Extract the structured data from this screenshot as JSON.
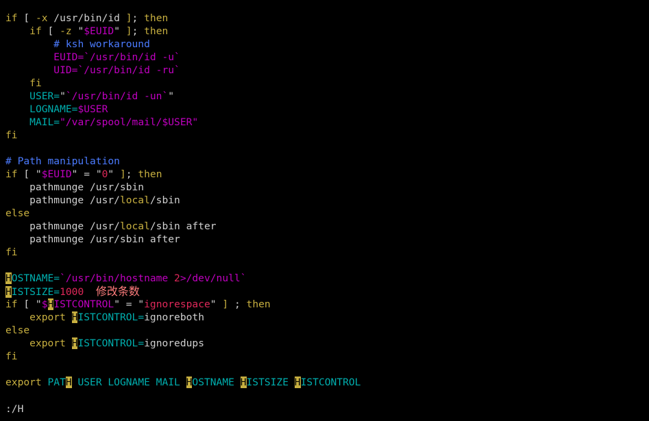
{
  "colors": {
    "background": "#000000",
    "default": "#d0d0d0",
    "keyword": "#c8b040",
    "variable": "#00afaf",
    "string": "#c000c0",
    "comment": "#4b7bff",
    "special": "#c000c0",
    "number": "#e0285a",
    "search_bg": "#c8b040",
    "search_fg": "#000000",
    "annotation": "#ff7d7d"
  },
  "editor": {
    "lines": [
      [
        {
          "t": "if",
          "c": "keyword"
        },
        {
          "t": " [ ",
          "c": "default"
        },
        {
          "t": "-x",
          "c": "keyword"
        },
        {
          "t": " /usr/bin/id ",
          "c": "default"
        },
        {
          "t": "]",
          "c": "keyword"
        },
        {
          "t": "; ",
          "c": "default"
        },
        {
          "t": "then",
          "c": "keyword"
        }
      ],
      [
        {
          "t": "    ",
          "c": "default"
        },
        {
          "t": "if",
          "c": "keyword"
        },
        {
          "t": " [ ",
          "c": "default"
        },
        {
          "t": "-z",
          "c": "keyword"
        },
        {
          "t": " \"",
          "c": "default"
        },
        {
          "t": "$EUID",
          "c": "special"
        },
        {
          "t": "\" ",
          "c": "default"
        },
        {
          "t": "]",
          "c": "keyword"
        },
        {
          "t": "; ",
          "c": "default"
        },
        {
          "t": "then",
          "c": "keyword"
        }
      ],
      [
        {
          "t": "        ",
          "c": "default"
        },
        {
          "t": "# ksh workaround",
          "c": "comment"
        }
      ],
      [
        {
          "t": "        ",
          "c": "default"
        },
        {
          "t": "EUID=",
          "c": "special"
        },
        {
          "t": "`/usr/bin/id -u`",
          "c": "string"
        }
      ],
      [
        {
          "t": "        ",
          "c": "default"
        },
        {
          "t": "UID=",
          "c": "special"
        },
        {
          "t": "`/usr/bin/id -ru`",
          "c": "string"
        }
      ],
      [
        {
          "t": "    ",
          "c": "default"
        },
        {
          "t": "fi",
          "c": "keyword"
        }
      ],
      [
        {
          "t": "    ",
          "c": "default"
        },
        {
          "t": "USER=",
          "c": "variable"
        },
        {
          "t": "\"",
          "c": "default"
        },
        {
          "t": "`/usr/bin/id -un`",
          "c": "string"
        },
        {
          "t": "\"",
          "c": "default"
        }
      ],
      [
        {
          "t": "    ",
          "c": "default"
        },
        {
          "t": "LOGNAME=",
          "c": "variable"
        },
        {
          "t": "$USER",
          "c": "special"
        }
      ],
      [
        {
          "t": "    ",
          "c": "default"
        },
        {
          "t": "MAIL=",
          "c": "variable"
        },
        {
          "t": "\"/var/spool/mail/$USER\"",
          "c": "string"
        }
      ],
      [
        {
          "t": "fi",
          "c": "keyword"
        }
      ],
      [],
      [
        {
          "t": "# Path manipulation",
          "c": "comment"
        }
      ],
      [
        {
          "t": "if",
          "c": "keyword"
        },
        {
          "t": " [ \"",
          "c": "default"
        },
        {
          "t": "$EUID",
          "c": "special"
        },
        {
          "t": "\" = \"",
          "c": "default"
        },
        {
          "t": "0",
          "c": "number"
        },
        {
          "t": "\" ",
          "c": "default"
        },
        {
          "t": "]",
          "c": "keyword"
        },
        {
          "t": "; ",
          "c": "default"
        },
        {
          "t": "then",
          "c": "keyword"
        }
      ],
      [
        {
          "t": "    pathmunge /usr/sbin",
          "c": "default"
        }
      ],
      [
        {
          "t": "    pathmunge /usr/",
          "c": "default"
        },
        {
          "t": "local",
          "c": "keyword"
        },
        {
          "t": "/sbin",
          "c": "default"
        }
      ],
      [
        {
          "t": "else",
          "c": "keyword"
        }
      ],
      [
        {
          "t": "    pathmunge /usr/",
          "c": "default"
        },
        {
          "t": "local",
          "c": "keyword"
        },
        {
          "t": "/sbin after",
          "c": "default"
        }
      ],
      [
        {
          "t": "    pathmunge /usr/sbin after",
          "c": "default"
        }
      ],
      [
        {
          "t": "fi",
          "c": "keyword"
        }
      ],
      [],
      [
        {
          "t": "H",
          "c": "search"
        },
        {
          "t": "OSTNAME=",
          "c": "variable"
        },
        {
          "t": "`/usr/bin/hostname ",
          "c": "string"
        },
        {
          "t": "2",
          "c": "number"
        },
        {
          "t": ">/dev/null`",
          "c": "string"
        }
      ],
      [
        {
          "t": "H",
          "c": "search"
        },
        {
          "t": "ISTSIZE=",
          "c": "variable"
        },
        {
          "t": "1000",
          "c": "number"
        },
        {
          "t": "  ",
          "c": "default"
        },
        {
          "t": "修改条数",
          "c": "annotation"
        }
      ],
      [
        {
          "t": "if",
          "c": "keyword"
        },
        {
          "t": " [ \"",
          "c": "default"
        },
        {
          "t": "$",
          "c": "special"
        },
        {
          "t": "H",
          "c": "search"
        },
        {
          "t": "ISTCONTROL",
          "c": "special"
        },
        {
          "t": "\" = \"",
          "c": "default"
        },
        {
          "t": "ignorespace",
          "c": "number"
        },
        {
          "t": "\" ",
          "c": "default"
        },
        {
          "t": "]",
          "c": "keyword"
        },
        {
          "t": " ; ",
          "c": "default"
        },
        {
          "t": "then",
          "c": "keyword"
        }
      ],
      [
        {
          "t": "    ",
          "c": "default"
        },
        {
          "t": "export",
          "c": "keyword"
        },
        {
          "t": " ",
          "c": "default"
        },
        {
          "t": "H",
          "c": "search"
        },
        {
          "t": "ISTCONTROL=",
          "c": "variable"
        },
        {
          "t": "ignoreboth",
          "c": "default"
        }
      ],
      [
        {
          "t": "else",
          "c": "keyword"
        }
      ],
      [
        {
          "t": "    ",
          "c": "default"
        },
        {
          "t": "export",
          "c": "keyword"
        },
        {
          "t": " ",
          "c": "default"
        },
        {
          "t": "H",
          "c": "search"
        },
        {
          "t": "ISTCONTROL=",
          "c": "variable"
        },
        {
          "t": "ignoredups",
          "c": "default"
        }
      ],
      [
        {
          "t": "fi",
          "c": "keyword"
        }
      ],
      [],
      [
        {
          "t": "export",
          "c": "keyword"
        },
        {
          "t": " ",
          "c": "default"
        },
        {
          "t": "PAT",
          "c": "variable"
        },
        {
          "t": "H",
          "c": "search"
        },
        {
          "t": " USER LOGNAME MAIL ",
          "c": "variable"
        },
        {
          "t": "H",
          "c": "search"
        },
        {
          "t": "OSTNAME ",
          "c": "variable"
        },
        {
          "t": "H",
          "c": "search"
        },
        {
          "t": "ISTSIZE ",
          "c": "variable"
        },
        {
          "t": "H",
          "c": "search"
        },
        {
          "t": "ISTCONTROL",
          "c": "variable"
        }
      ]
    ]
  },
  "command_line": ":/H"
}
